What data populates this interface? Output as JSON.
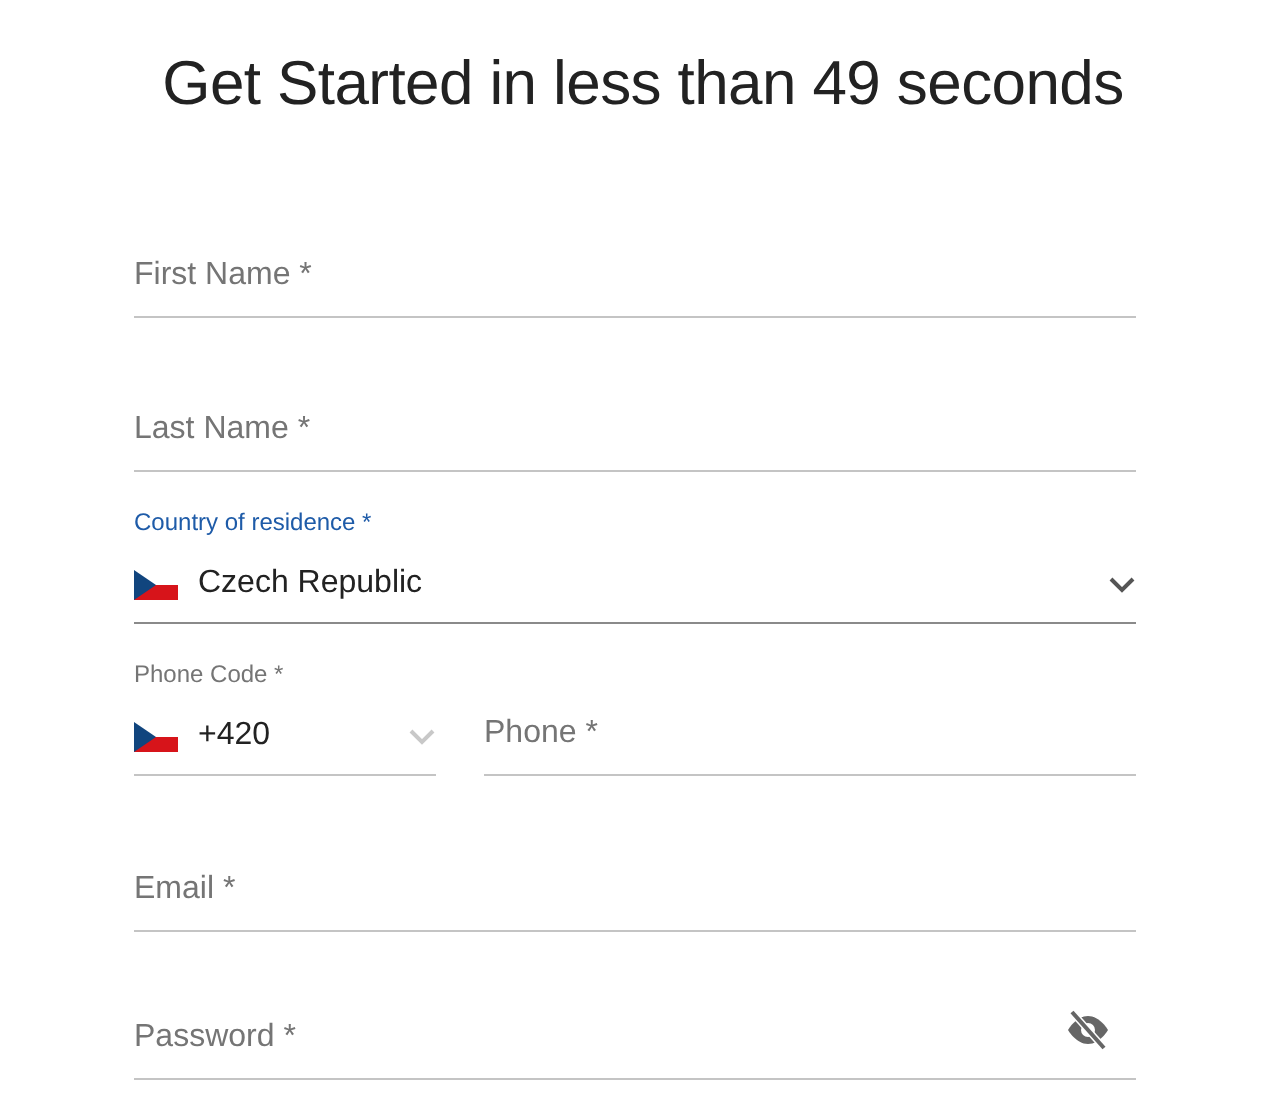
{
  "title": "Get Started in less than 49 seconds",
  "fields": [
    {
      "kind": "text",
      "placeholder": "First Name *"
    },
    {
      "kind": "text",
      "placeholder": "Last Name *"
    },
    {
      "kind": "select",
      "label": "Country of residence *",
      "value": "Czech Republic",
      "focused": true
    },
    {
      "kind": "phone",
      "code": {
        "label": "Phone Code *",
        "value": "+420"
      },
      "phone": {
        "placeholder": "Phone *"
      }
    },
    {
      "kind": "text",
      "placeholder": "Email *"
    },
    {
      "kind": "password",
      "placeholder": "Password *"
    }
  ]
}
